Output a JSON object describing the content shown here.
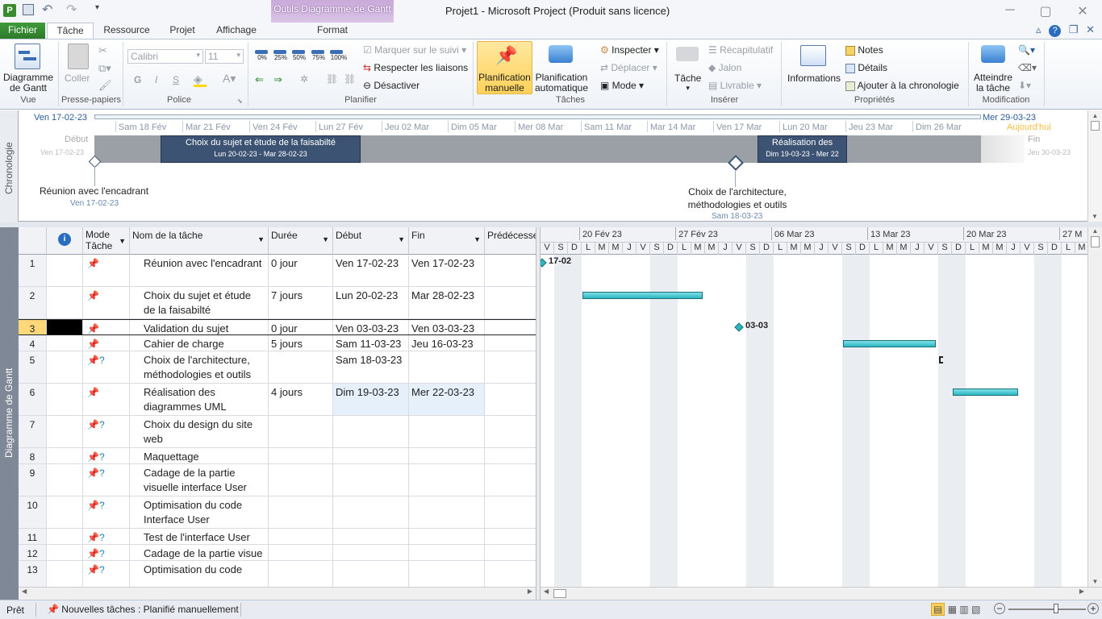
{
  "window": {
    "title": "Projet1 -  Microsoft Project (Produit sans licence)",
    "context_tab_group": "Outils Diagramme de Gantt"
  },
  "tabs": [
    "Fichier",
    "Tâche",
    "Ressource",
    "Projet",
    "Affichage",
    "Format"
  ],
  "ribbon": {
    "vue": {
      "gantt_button": "Diagramme de Gantt",
      "group": "Vue"
    },
    "presse_papiers": {
      "paste": "Coller",
      "group": "Presse-papiers"
    },
    "police": {
      "font": "Calibri",
      "size": "11",
      "bold": "G",
      "italic": "I",
      "underline": "S",
      "group": "Police"
    },
    "planifier": {
      "pcts": [
        "0%",
        "25%",
        "50%",
        "75%",
        "100%"
      ],
      "mark": "Marquer sur le suivi",
      "respect": "Respecter les liaisons",
      "deactivate": "Désactiver",
      "group": "Planifier"
    },
    "taches": {
      "manual": "Planification manuelle",
      "auto": "Planification automatique",
      "inspect": "Inspecter",
      "move": "Déplacer",
      "mode": "Mode",
      "group": "Tâches"
    },
    "inserer": {
      "task": "Tâche",
      "summary": "Récapitulatif",
      "milestone": "Jalon",
      "deliverable": "Livrable",
      "group": "Insérer"
    },
    "proprietes": {
      "info": "Informations",
      "notes": "Notes",
      "details": "Détails",
      "add_timeline": "Ajouter à la chronologie",
      "group": "Propriétés"
    },
    "modification": {
      "goto": "Atteindre la tâche",
      "group": "Modification"
    }
  },
  "timeline": {
    "side_label": "Chronologie",
    "start_date": "Ven 17-02-23",
    "end_date": "Mer 29-03-23",
    "today": "Aujourd'hui",
    "start_label": "Début",
    "start_sub": "Ven 17-02-23",
    "end_label": "Fin",
    "end_sub": "Jeu 30-03-23",
    "scale": [
      "Sam 18 Fév",
      "Mar 21 Fév",
      "Ven 24 Fév",
      "Lun 27 Fév",
      "Jeu 02 Mar",
      "Dim 05 Mar",
      "Mer 08 Mar",
      "Sam 11 Mar",
      "Mar 14 Mar",
      "Ven 17 Mar",
      "Lun 20 Mar",
      "Jeu 23 Mar",
      "Dim 26 Mar"
    ],
    "bar1_title": "Choix du sujet et étude de la faisabilté",
    "bar1_dates": "Lun 20-02-23 - Mar 28-02-23",
    "bar2_title": "Réalisation des",
    "bar2_dates": "Dim 19-03-23 - Mer 22",
    "ms1_title": "Réunion avec l'encadrant",
    "ms1_date": "Ven 17-02-23",
    "ms2_title1": "Choix de l'architecture,",
    "ms2_title2": "méthodologies et outils",
    "ms2_date": "Sam 18-03-23"
  },
  "grid": {
    "side_label": "Diagramme de Gantt",
    "headers": {
      "mode": "Mode Tâche",
      "name": "Nom de la tâche",
      "duration": "Durée",
      "start": "Début",
      "end": "Fin",
      "pred": "Prédécesse"
    },
    "rows": [
      {
        "id": "1",
        "name": "Réunion avec l'encadrant",
        "duration": "0 jour",
        "start": "Ven 17-02-23",
        "end": "Ven 17-02-23",
        "mode": "manual"
      },
      {
        "id": "2",
        "name": "Choix du sujet et étude de la faisabilté",
        "duration": "7 jours",
        "start": "Lun 20-02-23",
        "end": "Mar 28-02-23",
        "mode": "manual"
      },
      {
        "id": "3",
        "name": "Validation du sujet",
        "duration": "0 jour",
        "start": "Ven 03-03-23",
        "end": "Ven 03-03-23",
        "mode": "manual"
      },
      {
        "id": "4",
        "name": "Cahier de charge",
        "duration": "5 jours",
        "start": "Sam 11-03-23",
        "end": "Jeu 16-03-23",
        "mode": "manual"
      },
      {
        "id": "5",
        "name": "Choix de l'architecture, méthodologies et outils",
        "duration": "",
        "start": "Sam 18-03-23",
        "end": "",
        "mode": "manual-q"
      },
      {
        "id": "6",
        "name": "Réalisation des diagrammes UML",
        "duration": "4 jours",
        "start": "Dim 19-03-23",
        "end": "Mer 22-03-23",
        "mode": "manual"
      },
      {
        "id": "7",
        "name": "Choix du design du site web",
        "duration": "",
        "start": "",
        "end": "",
        "mode": "manual-q"
      },
      {
        "id": "8",
        "name": "Maquettage",
        "duration": "",
        "start": "",
        "end": "",
        "mode": "manual-q"
      },
      {
        "id": "9",
        "name": "Cadage de la partie visuelle interface User",
        "duration": "",
        "start": "",
        "end": "",
        "mode": "manual-q"
      },
      {
        "id": "10",
        "name": "Optimisation du code Interface User",
        "duration": "",
        "start": "",
        "end": "",
        "mode": "manual-q"
      },
      {
        "id": "11",
        "name": "Test de l'interface User",
        "duration": "",
        "start": "",
        "end": "",
        "mode": "manual-q"
      },
      {
        "id": "12",
        "name": "Cadage de la partie visue",
        "duration": "",
        "start": "",
        "end": "",
        "mode": "manual-q"
      },
      {
        "id": "13",
        "name": "Optimisation du code",
        "duration": "",
        "start": "",
        "end": "",
        "mode": "manual-q"
      }
    ]
  },
  "chart": {
    "weeks": [
      "20 Fév 23",
      "27 Fév 23",
      "06 Mar 23",
      "13 Mar 23",
      "20 Mar 23",
      "27 M"
    ],
    "days": [
      "V",
      "S",
      "D",
      "L",
      "M",
      "M",
      "J",
      "V",
      "S",
      "D",
      "L",
      "M",
      "M",
      "J",
      "V",
      "S",
      "D",
      "L",
      "M",
      "M",
      "J",
      "V",
      "S",
      "D",
      "L",
      "M",
      "M",
      "J",
      "V",
      "S",
      "D",
      "L",
      "M",
      "M",
      "J",
      "V",
      "S",
      "D",
      "L",
      "M"
    ],
    "ms1_label": "17-02",
    "ms3_label": "03-03"
  },
  "status": {
    "ready": "Prêt",
    "new_tasks": "Nouvelles tâches : Planifié manuellement"
  }
}
